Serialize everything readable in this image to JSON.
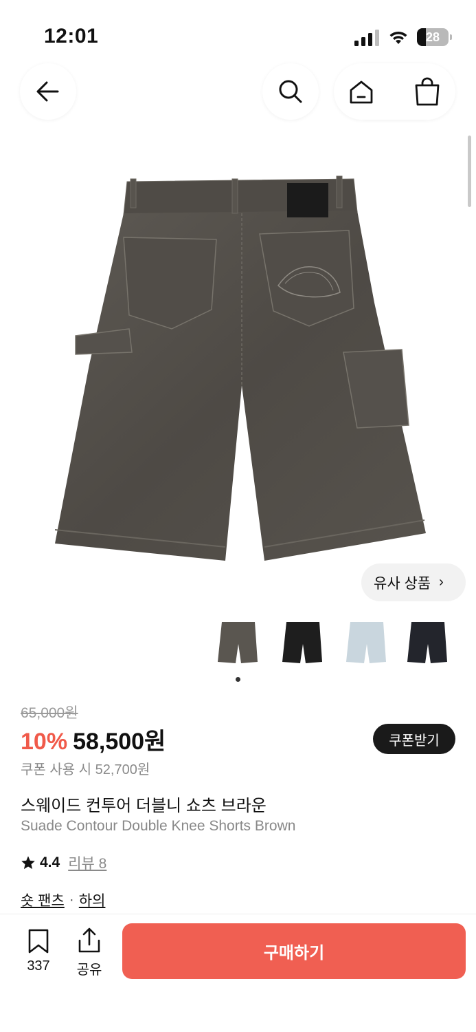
{
  "status_bar": {
    "time": "12:01",
    "battery": "28",
    "battery_level": 0.28
  },
  "nav": {
    "back_icon": "arrow-left-icon",
    "search_icon": "search-icon",
    "home_icon": "home-icon",
    "cart_icon": "shopping-bag-icon"
  },
  "product": {
    "image_alt_icon": "shorts-back-image",
    "similar_button": "유사 상품",
    "thumbnails": [
      {
        "name": "brown",
        "color": "#5a5650"
      },
      {
        "name": "black",
        "color": "#1e1e1e"
      },
      {
        "name": "light-blue",
        "color": "#c9d6de"
      },
      {
        "name": "navy",
        "color": "#23252c"
      }
    ],
    "original_price": "65,000원",
    "discount": "10%",
    "price": "58,500원",
    "coupon_button": "쿠폰받기",
    "coupon_price": "쿠폰 사용 시 52,700원",
    "title_ko": "스웨이드 컨투어 더블니 쇼츠 브라운",
    "title_en": "Suade Contour Double Knee Shorts Brown",
    "rating": "4.4",
    "review_label": "리뷰 8",
    "category_primary": "숏 팬츠",
    "category_separator": "·",
    "category_secondary": "하의"
  },
  "bottom_bar": {
    "bookmark_count": "337",
    "share_label": "공유",
    "buy_button": "구매하기"
  },
  "colors": {
    "accent": "#f05f52",
    "discount": "#f05a4a",
    "dark_button": "#1a1a1a"
  }
}
